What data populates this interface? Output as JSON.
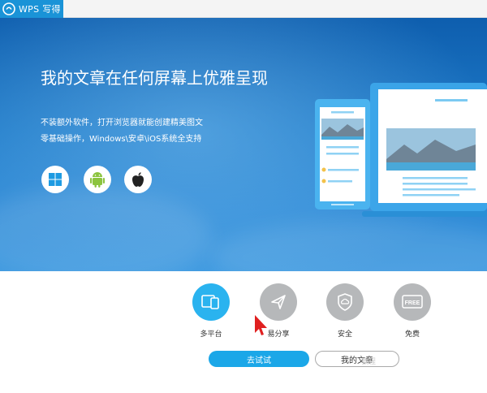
{
  "app": {
    "brand": "WPS 写得",
    "logo": "wps-logo-icon"
  },
  "hero": {
    "headline": "我的文章在任何屏幕上优雅呈现",
    "subtitle_line1": "不装额外软件，打开浏览器就能创建精美图文",
    "subtitle_line2": "零基础操作，Windows\\安卓\\iOS系统全支持",
    "platform_icons": [
      "windows-icon",
      "android-icon",
      "apple-icon"
    ]
  },
  "features": [
    {
      "label": "多平台",
      "icon": "multi-device-icon",
      "active": true
    },
    {
      "label": "易分享",
      "icon": "paper-plane-icon",
      "active": false
    },
    {
      "label": "安全",
      "icon": "shield-cloud-icon",
      "active": false
    },
    {
      "label": "免费",
      "icon": "free-tag-icon",
      "active": false
    }
  ],
  "buttons": {
    "try_label": "去试试",
    "my_articles_label": "我的文章"
  },
  "watermark": "教程",
  "colors": {
    "accent": "#1ba7e8",
    "hero_top": "#0e5eae",
    "hero_bottom": "#3a97df",
    "feature_inactive": "#b6b8ba",
    "logo_bg": "#1a93d7",
    "annotation_arrow": "#e02020"
  }
}
